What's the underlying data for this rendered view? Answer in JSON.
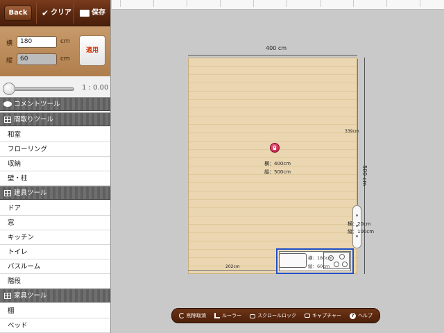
{
  "toolbar": {
    "back_label": "Back",
    "clear_label": "クリア",
    "save_label": "保存"
  },
  "size_panel": {
    "width_label": "横",
    "width_value": "180",
    "depth_label": "縦",
    "depth_value": "60",
    "unit": "cm",
    "apply_label": "適用"
  },
  "zoom": {
    "scale_text": "1 : 0.00",
    "slider_level": 0
  },
  "sidebar": {
    "sections": [
      {
        "label": "コメントツール",
        "items": []
      },
      {
        "label": "間取りツール",
        "items": [
          "和室",
          "フローリング",
          "収納",
          "壁・柱"
        ]
      },
      {
        "label": "建具ツール",
        "items": [
          "ドア",
          "窓",
          "キッチン",
          "トイレ",
          "バスルーム",
          "階段"
        ]
      },
      {
        "label": "家具ツール",
        "items": [
          "棚",
          "ベッド"
        ]
      }
    ]
  },
  "plan": {
    "room_width_text": "400 cm",
    "room_height_text": "500 cm",
    "room_info_w": "横：400cm",
    "room_info_h": "縦：500cm",
    "right_gap_text": "339cm",
    "left_gap_text": "202cm",
    "fixture_w": "横：20cm",
    "fixture_h": "縦：100cm",
    "kitchen_w": "横：180cm",
    "kitchen_h": "縦：60cm"
  },
  "bottom_bar": {
    "undo_label": "削除取消",
    "ruler_label": "ルーラー",
    "scroll_lock_label": "スクロールロック",
    "capture_label": "キャプチャー",
    "help_label": "ヘルプ"
  },
  "colors": {
    "toolbar_brown": "#5a2810",
    "panel_tan": "#c79a6b",
    "floor": "#ead6b0",
    "selection_blue": "#1f4fc7",
    "apply_red": "#d4380d"
  }
}
